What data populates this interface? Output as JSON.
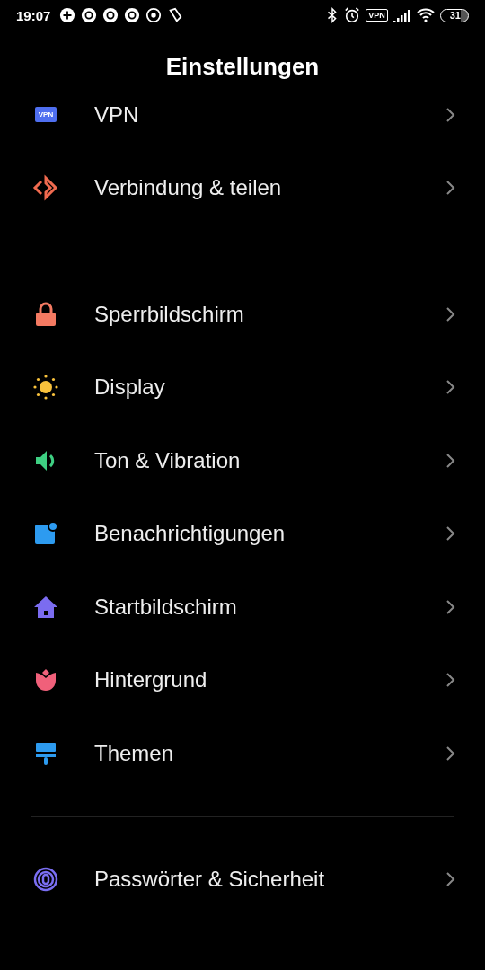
{
  "status_bar": {
    "time": "19:07",
    "vpn": "VPN",
    "battery": "31"
  },
  "title": "Einstellungen",
  "groups": [
    {
      "items": [
        {
          "label": "VPN",
          "kind": "vpn",
          "icon_text": "VPN"
        },
        {
          "label": "Verbindung & teilen",
          "kind": "share"
        }
      ]
    },
    {
      "items": [
        {
          "label": "Sperrbildschirm",
          "kind": "lock"
        },
        {
          "label": "Display",
          "kind": "sun"
        },
        {
          "label": "Ton & Vibration",
          "kind": "speaker"
        },
        {
          "label": "Benachrichtigungen",
          "kind": "notification"
        },
        {
          "label": "Startbildschirm",
          "kind": "home"
        },
        {
          "label": "Hintergrund",
          "kind": "tulip"
        },
        {
          "label": "Themen",
          "kind": "brush"
        }
      ]
    },
    {
      "items": [
        {
          "label": "Passwörter & Sicherheit",
          "kind": "fingerprint"
        }
      ]
    }
  ]
}
